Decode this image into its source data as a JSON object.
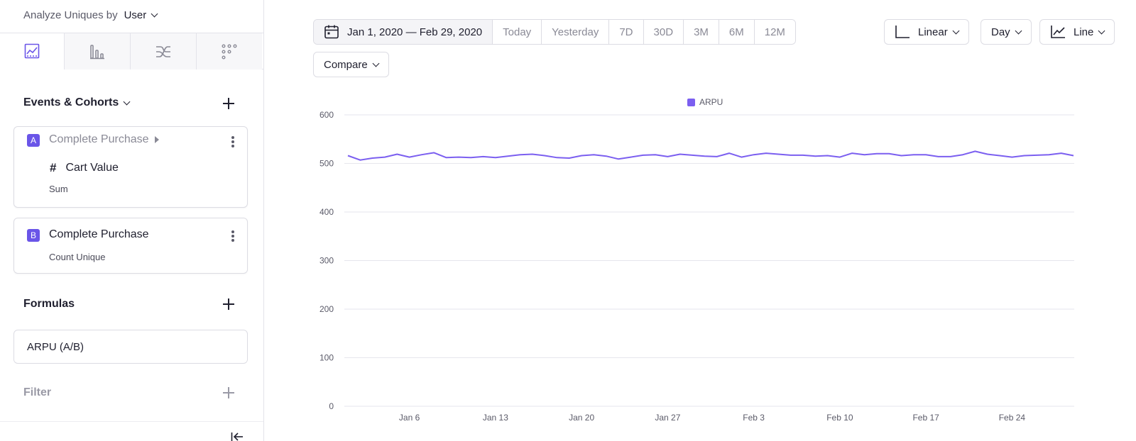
{
  "analyze": {
    "prefix": "Analyze Uniques by",
    "value": "User"
  },
  "viz_tabs": [
    {
      "name": "insights-icon",
      "active": true
    },
    {
      "name": "bar-chart-icon",
      "active": false
    },
    {
      "name": "flows-icon",
      "active": false
    },
    {
      "name": "grid-dots-icon",
      "active": false
    }
  ],
  "events_section": {
    "title": "Events & Cohorts"
  },
  "events": [
    {
      "badge": "A",
      "name": "Complete Purchase",
      "property": "Cart Value",
      "aggregation": "Sum"
    },
    {
      "badge": "B",
      "name": "Complete Purchase",
      "aggregation": "Count Unique"
    }
  ],
  "formulas_section": {
    "title": "Formulas"
  },
  "formula": {
    "label": "ARPU (A/B)"
  },
  "filter_section": {
    "title": "Filter"
  },
  "toolbar": {
    "date_range": "Jan 1, 2020 — Feb 29, 2020",
    "presets": [
      "Today",
      "Yesterday",
      "7D",
      "30D",
      "3M",
      "6M",
      "12M"
    ],
    "scale": "Linear",
    "interval": "Day",
    "chart_type": "Line",
    "compare": "Compare"
  },
  "colors": {
    "accent": "#6a55e8",
    "series": "#7b5ff0"
  },
  "chart_data": {
    "type": "line",
    "legend": [
      "ARPU"
    ],
    "legend_position": "top-center",
    "ylim": [
      0,
      600
    ],
    "yticks": [
      "0",
      "100",
      "200",
      "300",
      "400",
      "500",
      "600"
    ],
    "xtick_labels": [
      "Jan 6",
      "Jan 13",
      "Jan 20",
      "Jan 27",
      "Feb 3",
      "Feb 10",
      "Feb 17",
      "Feb 24"
    ],
    "xtick_dates": [
      "2020-01-06",
      "2020-01-13",
      "2020-01-20",
      "2020-01-27",
      "2020-02-03",
      "2020-02-10",
      "2020-02-17",
      "2020-02-24"
    ],
    "grid": true,
    "series": [
      {
        "name": "ARPU",
        "x": [
          "2020-01-01",
          "2020-01-02",
          "2020-01-03",
          "2020-01-04",
          "2020-01-05",
          "2020-01-06",
          "2020-01-07",
          "2020-01-08",
          "2020-01-09",
          "2020-01-10",
          "2020-01-11",
          "2020-01-12",
          "2020-01-13",
          "2020-01-14",
          "2020-01-15",
          "2020-01-16",
          "2020-01-17",
          "2020-01-18",
          "2020-01-19",
          "2020-01-20",
          "2020-01-21",
          "2020-01-22",
          "2020-01-23",
          "2020-01-24",
          "2020-01-25",
          "2020-01-26",
          "2020-01-27",
          "2020-01-28",
          "2020-01-29",
          "2020-01-30",
          "2020-01-31",
          "2020-02-01",
          "2020-02-02",
          "2020-02-03",
          "2020-02-04",
          "2020-02-05",
          "2020-02-06",
          "2020-02-07",
          "2020-02-08",
          "2020-02-09",
          "2020-02-10",
          "2020-02-11",
          "2020-02-12",
          "2020-02-13",
          "2020-02-14",
          "2020-02-15",
          "2020-02-16",
          "2020-02-17",
          "2020-02-18",
          "2020-02-19",
          "2020-02-20",
          "2020-02-21",
          "2020-02-22",
          "2020-02-23",
          "2020-02-24",
          "2020-02-25",
          "2020-02-26",
          "2020-02-27",
          "2020-02-28",
          "2020-02-29"
        ],
        "values": [
          516,
          507,
          511,
          513,
          519,
          513,
          518,
          522,
          512,
          513,
          512,
          514,
          512,
          515,
          518,
          519,
          516,
          512,
          511,
          516,
          518,
          515,
          509,
          513,
          517,
          518,
          514,
          519,
          517,
          515,
          514,
          521,
          513,
          518,
          521,
          519,
          517,
          517,
          515,
          516,
          513,
          521,
          518,
          520,
          520,
          516,
          518,
          518,
          514,
          514,
          518,
          525,
          519,
          516,
          513,
          516,
          517,
          518,
          521,
          516
        ]
      }
    ]
  }
}
